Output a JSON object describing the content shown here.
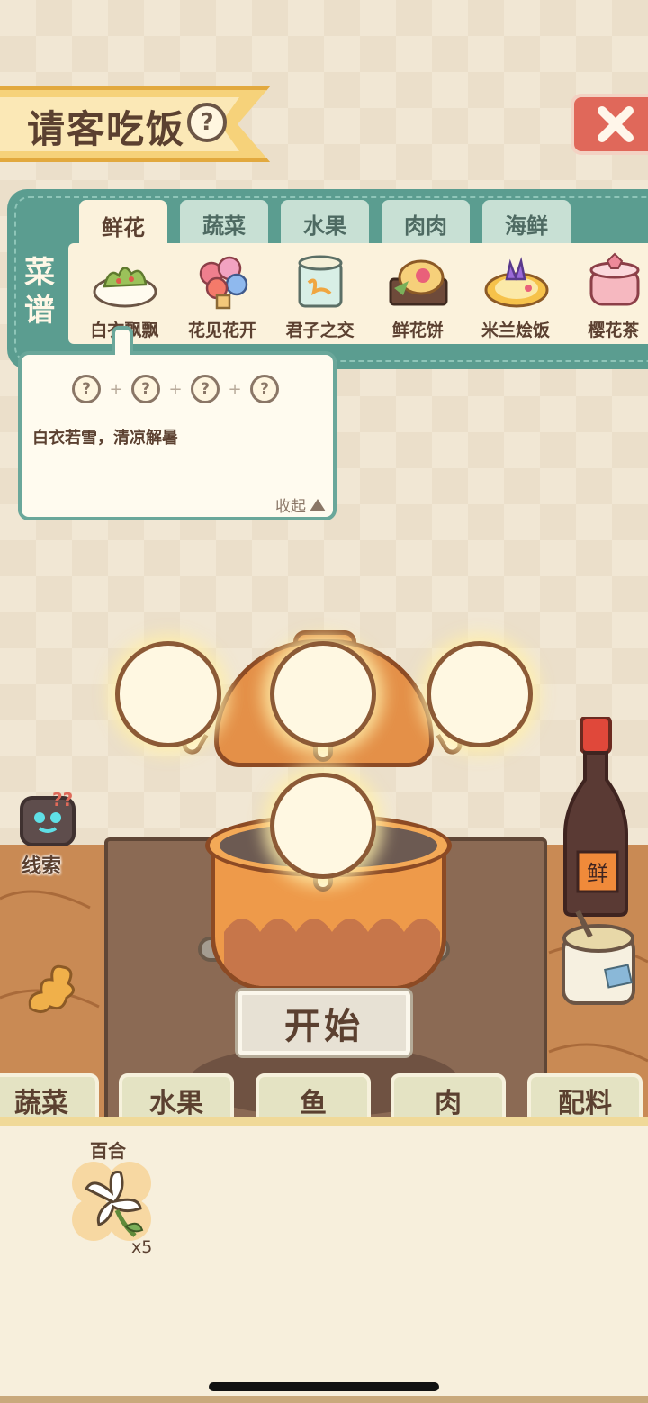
{
  "header": {
    "title": "请客吃饭",
    "help_symbol": "?"
  },
  "recipe_book": {
    "label": "菜谱",
    "tabs": [
      "鲜花",
      "蔬菜",
      "水果",
      "肉肉",
      "海鲜"
    ],
    "active_tab": "鲜花",
    "dishes": [
      {
        "name": "白衣飘飘",
        "icon": "salad-plate-icon"
      },
      {
        "name": "花见花开",
        "icon": "flower-bouquet-icon"
      },
      {
        "name": "君子之交",
        "icon": "jelly-cup-icon"
      },
      {
        "name": "鲜花饼",
        "icon": "flower-cake-icon"
      },
      {
        "name": "米兰烩饭",
        "icon": "risotto-plate-icon"
      },
      {
        "name": "樱花茶",
        "icon": "sakura-tea-icon"
      }
    ]
  },
  "tooltip": {
    "slots": [
      "?",
      "?",
      "?",
      "?"
    ],
    "plus": "+",
    "description": "白衣若雪，清凉解暑",
    "collapse_label": "收起"
  },
  "kitchen": {
    "start_label": "开始",
    "clue_label": "线索",
    "clue_marks": "??",
    "bottle_label": "鲜"
  },
  "categories": [
    "蔬菜",
    "水果",
    "鱼",
    "肉",
    "配料"
  ],
  "inventory": [
    {
      "name": "百合",
      "count": "x5",
      "icon": "lily-flower-icon"
    }
  ],
  "colors": {
    "panel_teal": "#5b9d90",
    "banner_gold": "#f6d27a",
    "close_red": "#e0685a",
    "pot_orange": "#ee9a4a"
  }
}
